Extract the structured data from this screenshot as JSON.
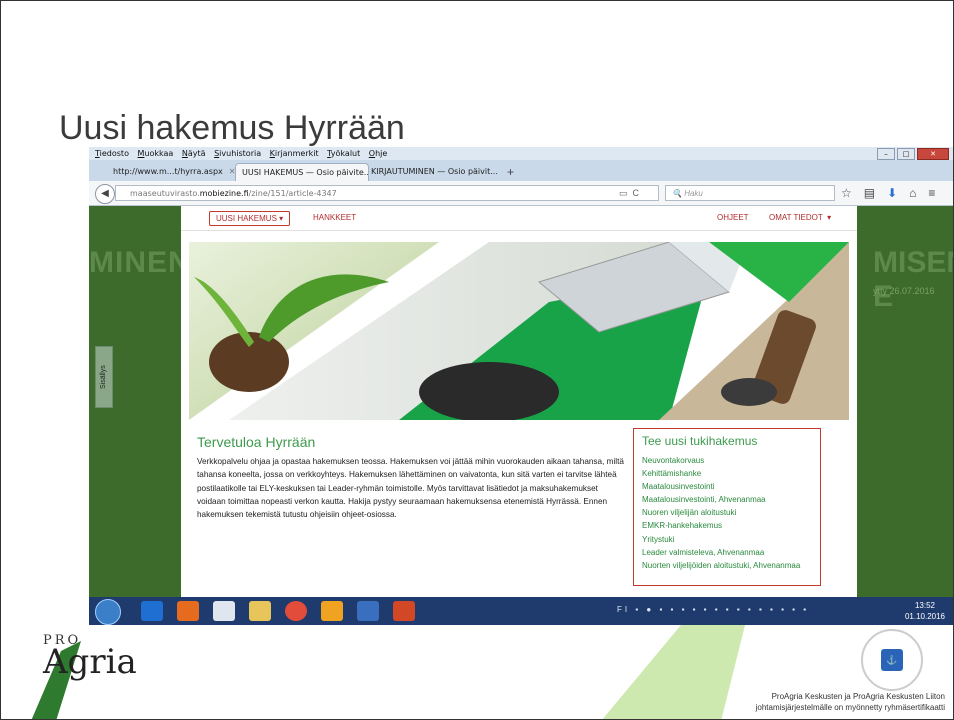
{
  "slide": {
    "title": "Uusi hakemus Hyrrään",
    "footer_line1": "ProAgria Keskusten ja ProAgria Keskusten Liiton",
    "footer_line2": "johtamisjärjestelmälle on myönnetty ryhmäsertifikaatti",
    "logo_pro": "PRO",
    "logo_agria": "Agria"
  },
  "browser": {
    "menu": [
      "Tiedosto",
      "Muokkaa",
      "Näytä",
      "Sivuhistoria",
      "Kirjanmerkit",
      "Työkalut",
      "Ohje"
    ],
    "tabs": [
      {
        "label": "http://www.m...t/hyrra.aspx"
      },
      {
        "label": "UUSI HAKEMUS — Osio päivite..."
      },
      {
        "label": "KIRJAUTUMINEN — Osio päivit..."
      }
    ],
    "url_prefix": "maaseutuvirasto.",
    "url_domain": "mobiezine.fi",
    "url_path": "/zine/151/article-4347",
    "search_placeholder": "Haku"
  },
  "site": {
    "nav": {
      "new_application": "UUSI HAKEMUS",
      "projects": "HANKKEET",
      "instructions": "OHJEET",
      "my_info": "OMAT TIEDOT"
    },
    "side_tab": "Sisällys",
    "bg_left": "MINEN",
    "bg_right": "MISEN E",
    "bg_date": "ytty 26.07.2016",
    "welcome_title": "Tervetuloa Hyrrään",
    "welcome_text": "Verkkopalvelu ohjaa ja opastaa hakemuksen teossa. Hakemuksen voi jättää mihin vuorokauden aikaan tahansa, miltä tahansa koneelta, jossa on verkkoyhteys. Hakemuksen lähettäminen on vaivatonta, kun sitä varten ei tarvitse lähteä postilaatikolle tai ELY-keskuksen tai Leader-ryhmän toimistolle. Myös tarvittavat lisätiedot ja maksuhakemukset voidaan toimittaa nopeasti verkon kautta. Hakija pystyy seuraamaan hakemuksensa etenemistä Hyrrässä. Ennen hakemuksen tekemistä tutustu ohjeisiin ohjeet-osiossa.",
    "apply_title": "Tee uusi tukihakemus",
    "apply_links": [
      "Neuvontakorvaus",
      "Kehittämishanke",
      "Maatalousinvestointi",
      "Maatalousinvestointi, Ahvenanmaa",
      "Nuoren viljelijän aloitustuki",
      "EMKR-hankehakemus",
      "Yritystuki",
      "Leader valmisteleva, Ahvenanmaa",
      "Nuorten viljelijöiden aloitustuki, Ahvenanmaa"
    ]
  },
  "taskbar": {
    "lang": "FI",
    "time": "13:52",
    "date": "01.10.2016"
  },
  "colors": {
    "accent_green": "#3f9a4e",
    "nav_red": "#b22d2d",
    "bg_dark_green": "#3c6b2c",
    "taskbar_blue": "#1f3b6e"
  }
}
